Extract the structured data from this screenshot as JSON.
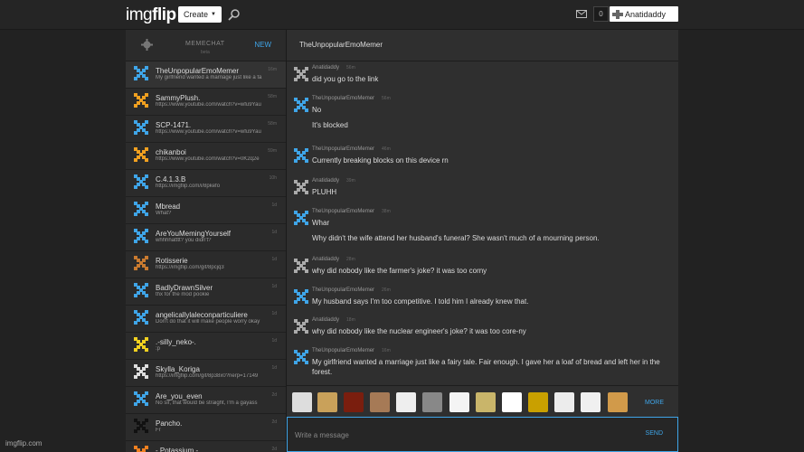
{
  "header": {
    "logo_prefix": "img",
    "logo_suffix": "flip",
    "create_label": "Create",
    "notification_count": "0",
    "username": "Anatidaddy"
  },
  "sidebar": {
    "title": "MEMECHAT",
    "subtitle": "beta",
    "new_label": "NEW",
    "conversations": [
      {
        "name": "TheUnpopularEmoMemer",
        "preview": "My girlfriend wanted a marriage just like a fa",
        "time": "16m",
        "color": "#3fa5e8"
      },
      {
        "name": "SammyPlush.",
        "preview": "https://www.youtube.com/watch?v=wfu9Yau",
        "time": "58m",
        "color": "#f0a020"
      },
      {
        "name": "SCP-1471.",
        "preview": "https://www.youtube.com/watch?v=wfu9Yau",
        "time": "58m",
        "color": "#3fa5e8"
      },
      {
        "name": "chikanboi",
        "preview": "https://www.youtube.com/watch?v=0K2q2e",
        "time": "59m",
        "color": "#f0a020"
      },
      {
        "name": "C.4.1.3.B",
        "preview": "https://imgflip.com/i/8pkefo",
        "time": "10h",
        "color": "#3fa5e8"
      },
      {
        "name": "Mbread",
        "preview": "What?",
        "time": "1d",
        "color": "#3fa5e8"
      },
      {
        "name": "AreYouMemingYourself",
        "preview": "whhhhatttt? you didn't?",
        "time": "1d",
        "color": "#3fa5e8"
      },
      {
        "name": "Rotisserie",
        "preview": "https://imgflip.com/gif/8pcjq3",
        "time": "1d",
        "color": "#c87a30"
      },
      {
        "name": "BadlyDrawnSilver",
        "preview": "thx for the mod pookie",
        "time": "1d",
        "color": "#3fa5e8"
      },
      {
        "name": "angelicallylaleconparticuliere",
        "preview": "Don't do that it will make people worry okay",
        "time": "1d",
        "color": "#3fa5e8"
      },
      {
        "name": ".-silly_neko-.",
        "preview": ":p",
        "time": "1d",
        "color": "#f0d020"
      },
      {
        "name": "Skylla_Koriga",
        "preview": "https://imgflip.com/gif/8p38x0?nerp=17149",
        "time": "1d",
        "color": "#dddddd"
      },
      {
        "name": "Are_you_even",
        "preview": "No sir, that would be straight, I'm a gayass",
        "time": "2d",
        "color": "#3fa5e8"
      },
      {
        "name": "Pancho.",
        "preview": "Fr",
        "time": "2d",
        "color": "#111111"
      },
      {
        "name": "- Potassium -",
        "preview": "",
        "time": "2d",
        "color": "#f08020"
      }
    ]
  },
  "chat": {
    "title": "TheUnpopularEmoMemer",
    "messages": [
      {
        "who": "Anatidaddy",
        "time": "56m",
        "lines": [
          "did you go to the link"
        ],
        "self": true
      },
      {
        "who": "TheUnpopularEmoMemer",
        "time": "56m",
        "lines": [
          "No",
          "It's blocked"
        ],
        "self": false
      },
      {
        "who": "TheUnpopularEmoMemer",
        "time": "46m",
        "lines": [
          "Currently breaking blocks on this device rn"
        ],
        "self": false
      },
      {
        "who": "Anatidaddy",
        "time": "39m",
        "lines": [
          "PLUHH"
        ],
        "self": true
      },
      {
        "who": "TheUnpopularEmoMemer",
        "time": "38m",
        "lines": [
          "Whar",
          "Why didn't the wife attend her husband's funeral? She wasn't much of a mourning person."
        ],
        "self": false
      },
      {
        "who": "Anatidaddy",
        "time": "28m",
        "lines": [
          "why did nobody like the farmer's joke? it was too corny"
        ],
        "self": true
      },
      {
        "who": "TheUnpopularEmoMemer",
        "time": "26m",
        "lines": [
          "My husband says I'm too competitive. I told him I already knew that."
        ],
        "self": false
      },
      {
        "who": "Anatidaddy",
        "time": "18m",
        "lines": [
          "why did nobody like the nuclear engineer's joke? it was too core-ny"
        ],
        "self": true
      },
      {
        "who": "TheUnpopularEmoMemer",
        "time": "16m",
        "lines": [
          "My girlfriend wanted a marriage just like a fairy tale. Fair enough. I gave her a loaf of bread and left her in the forest."
        ],
        "self": false
      }
    ],
    "more_label": "MORE",
    "input_placeholder": "Write a message",
    "send_label": "SEND"
  },
  "footer": {
    "brand": "imgflip.com"
  },
  "colors": {
    "accent": "#3fa5e8",
    "background": "#222222",
    "panel": "#2f2f2f"
  }
}
